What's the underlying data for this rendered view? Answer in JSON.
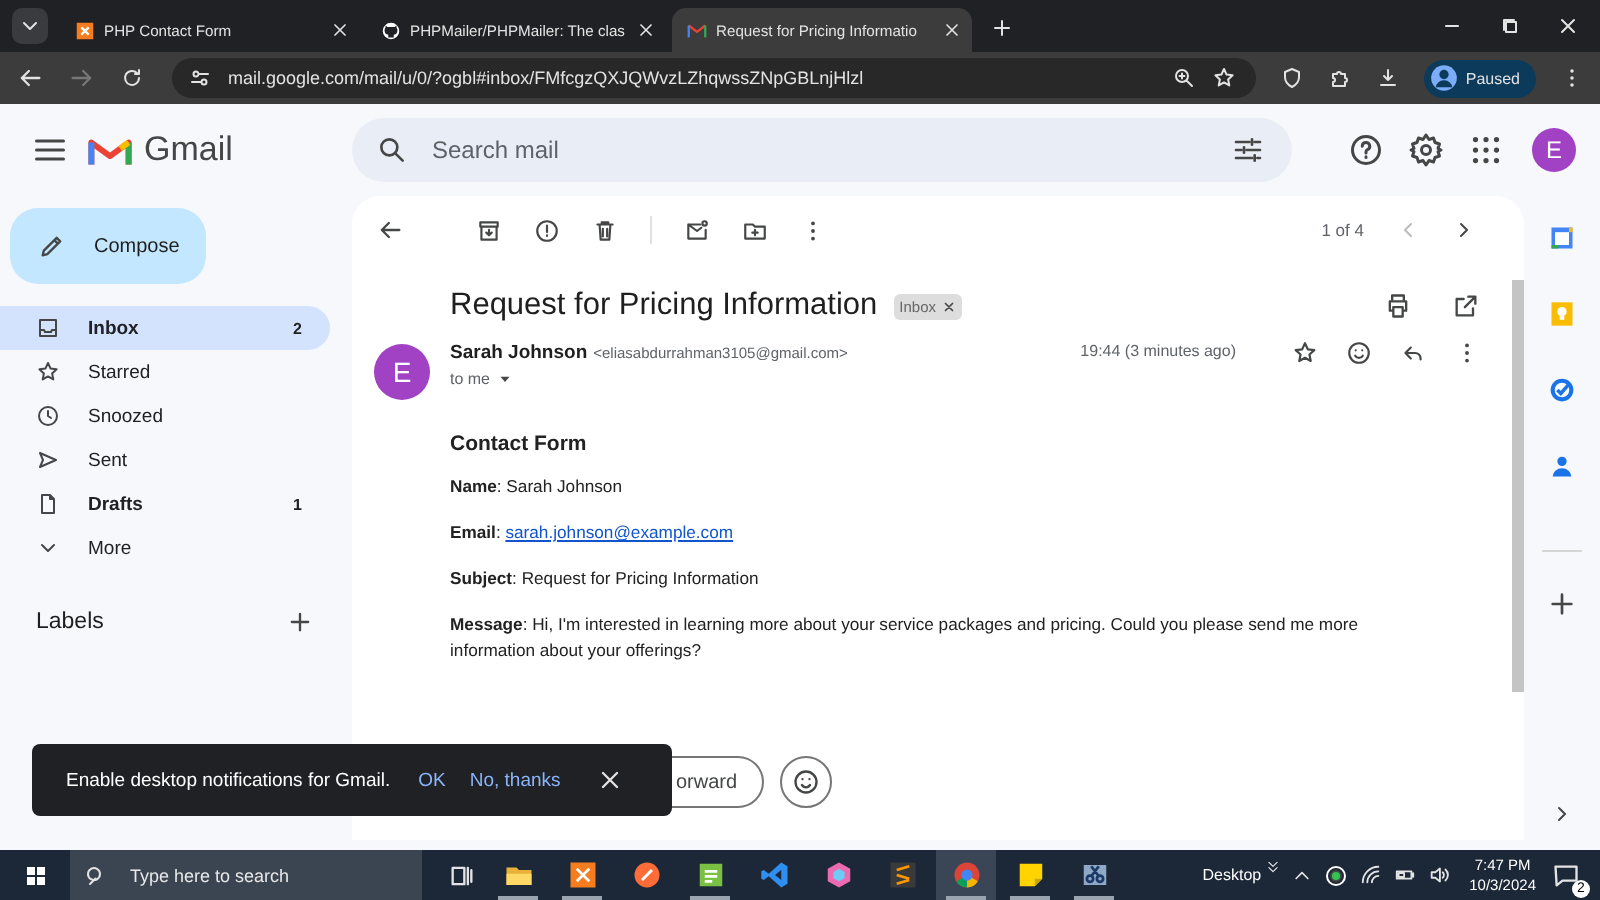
{
  "browser": {
    "tabs": [
      {
        "title": "PHP Contact Form",
        "kind": "xampp",
        "selected": false
      },
      {
        "title": "PHPMailer/PHPMailer: The clas",
        "kind": "github",
        "selected": false
      },
      {
        "title": "Request for Pricing Informatio",
        "kind": "gmail",
        "selected": true
      }
    ],
    "url": "mail.google.com/mail/u/0/?ogbl#inbox/FMfcgzQXJQWvzLZhqwssZNpGBLnjHlzl",
    "profile": "Paused"
  },
  "gmail": {
    "brand": "Gmail",
    "search": {
      "placeholder": "Search mail"
    },
    "account": "E",
    "compose": "Compose",
    "nav": [
      {
        "label": "Inbox",
        "kind": "inbox",
        "count": "2",
        "unread": true,
        "selected": true
      },
      {
        "label": "Starred",
        "kind": "starred",
        "unread": false,
        "selected": false
      },
      {
        "label": "Snoozed",
        "kind": "snoozed",
        "unread": false,
        "selected": false
      },
      {
        "label": "Sent",
        "kind": "sent",
        "unread": false,
        "selected": false
      },
      {
        "label": "Drafts",
        "kind": "drafts",
        "count": "1",
        "unread": true,
        "selected": false
      },
      {
        "label": "More",
        "kind": "more",
        "unread": false,
        "selected": false
      }
    ],
    "labels_heading": "Labels",
    "pager": "1 of 4",
    "email": {
      "subject": "Request for Pricing Information",
      "label": "Inbox",
      "sender": "Sarah Johnson",
      "sender_email": "<eliasabdurrahman3105@gmail.com>",
      "recipient": "to me",
      "time": "19:44 (3 minutes ago)",
      "avatar": "E",
      "heading": "Contact Form",
      "fields": [
        {
          "kind": "text",
          "text": "**Name**: Sarah Johnson"
        },
        {
          "kind": "link",
          "text": "**Email**:",
          "link": "sarah.johnson@example.com"
        },
        {
          "kind": "text",
          "text": "**Subject**: Request for Pricing Information"
        },
        {
          "kind": "text",
          "text": "**Message**: Hi, I'm interested in learning more about your service packages and pricing. Could you please send me more information about your offerings?"
        }
      ]
    },
    "forward": "orward",
    "snackbar": {
      "text": "Enable desktop notifications for Gmail.",
      "ok": "OK",
      "dismiss": "No, thanks"
    }
  },
  "taskbar": {
    "search": {
      "placeholder": "Type here to search"
    },
    "apps": [
      {
        "kind": "explorer",
        "running": true,
        "selected": false
      },
      {
        "kind": "xampp",
        "running": true,
        "selected": false
      },
      {
        "kind": "pen",
        "running": false,
        "selected": false
      },
      {
        "kind": "notepad",
        "running": true,
        "selected": false
      },
      {
        "kind": "code",
        "running": false,
        "selected": false
      },
      {
        "kind": "hexagon",
        "running": false,
        "selected": false
      },
      {
        "kind": "stripes",
        "running": false,
        "selected": false
      },
      {
        "kind": "browser",
        "running": true,
        "selected": true
      },
      {
        "kind": "sticky",
        "running": true,
        "selected": false
      },
      {
        "kind": "scissors",
        "running": true,
        "selected": false
      }
    ],
    "desktop": "Desktop",
    "time": "7:47 PM",
    "date": "10/3/2024",
    "notifications": "2"
  }
}
